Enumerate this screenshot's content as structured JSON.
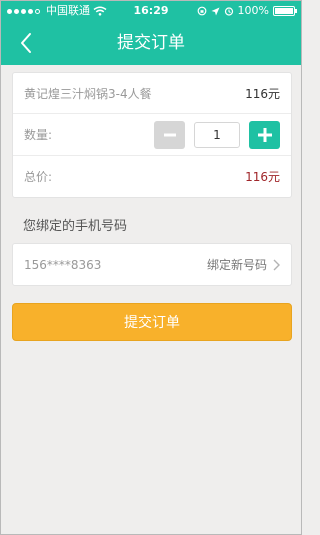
{
  "status": {
    "carrier": "中国联通",
    "time": "16:29",
    "battery": "100%"
  },
  "nav": {
    "title": "提交订单"
  },
  "order": {
    "item_name": "黄记煌三汁焖锅3-4人餐",
    "item_price": "116元",
    "qty_label": "数量:",
    "qty_value": "1",
    "total_label": "总价:",
    "total_value": "116元"
  },
  "phone": {
    "section_title": "您绑定的手机号码",
    "number": "156****8363",
    "bind_new_label": "绑定新号码"
  },
  "submit_label": "提交订单"
}
